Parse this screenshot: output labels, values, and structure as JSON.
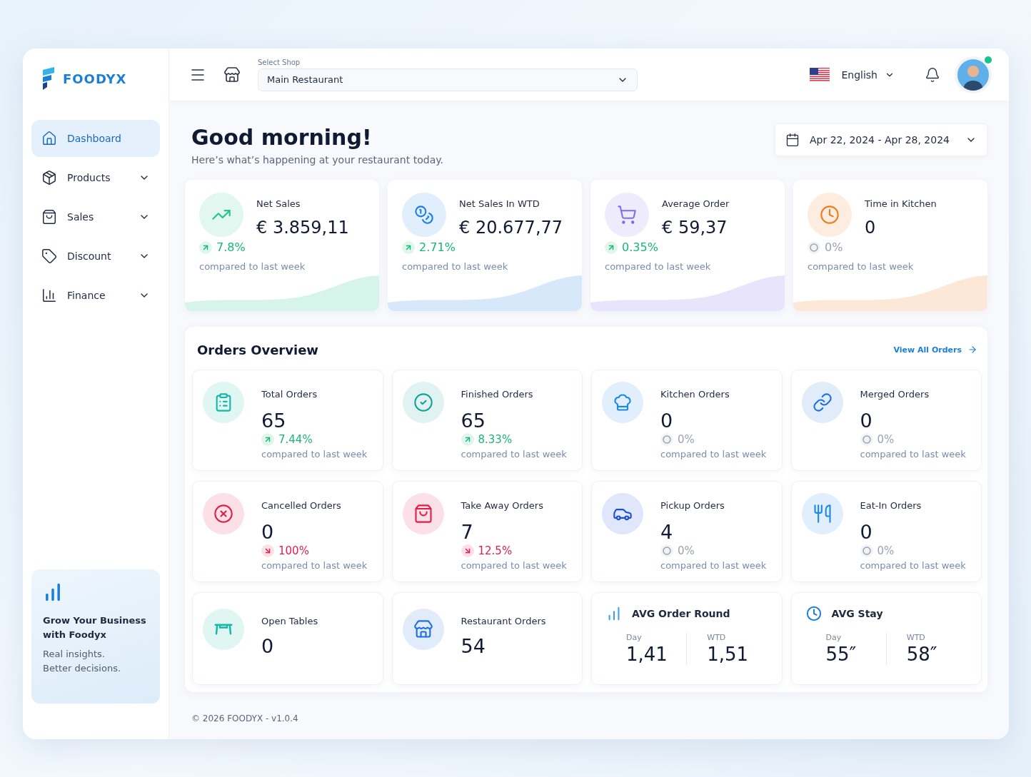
{
  "brand": {
    "name": "FOODYX"
  },
  "sidebar": {
    "items": [
      {
        "label": "Dashboard",
        "selected": true,
        "expandable": false
      },
      {
        "label": "Products",
        "selected": false,
        "expandable": true
      },
      {
        "label": "Sales",
        "selected": false,
        "expandable": true
      },
      {
        "label": "Discount",
        "selected": false,
        "expandable": true
      },
      {
        "label": "Finance",
        "selected": false,
        "expandable": true
      }
    ],
    "promo": {
      "title": "Grow Your Business with Foodyx",
      "text": "Real insights.\nBetter decisions."
    }
  },
  "header": {
    "shop_label": "Select Shop",
    "shop_value": "Main Restaurant",
    "language": "English",
    "avatar_online": true
  },
  "greeting": {
    "title": "Good morning!",
    "subtitle": "Here’s what’s happening at your restaurant today.",
    "date_range": "Apr 22, 2024 - Apr 28, 2024"
  },
  "kpis": [
    {
      "title": "Net Sales",
      "value": "€ 3.859,11",
      "change": {
        "kind": "up",
        "text": "7.8%"
      },
      "note": "compared to last week",
      "color": "#22c38e"
    },
    {
      "title": "Net Sales In WTD",
      "value": "€ 20.677,77",
      "change": {
        "kind": "up",
        "text": "2.71%"
      },
      "note": "compared to last week",
      "color": "#1e7ee6"
    },
    {
      "title": "Average Order",
      "value": "€ 59,37",
      "change": {
        "kind": "up",
        "text": "0.35%"
      },
      "note": "compared to last week",
      "color": "#7c6cf0"
    },
    {
      "title": "Time in Kitchen",
      "value": "0",
      "change": {
        "kind": "flat",
        "text": "0%"
      },
      "note": "compared to last week",
      "color": "#f27a1a"
    }
  ],
  "orders": {
    "title": "Orders Overview",
    "view_all": "View All Orders",
    "cards": [
      {
        "kind": "trend",
        "title": "Total Orders",
        "value": "65",
        "change": {
          "kind": "up",
          "text": "7.44%"
        },
        "note": "compared to last week",
        "color": "#14b8a6"
      },
      {
        "kind": "trend",
        "title": "Finished Orders",
        "value": "65",
        "change": {
          "kind": "up",
          "text": "8.33%"
        },
        "note": "compared to last week",
        "color": "#14a39a"
      },
      {
        "kind": "trend",
        "title": "Kitchen Orders",
        "value": "0",
        "change": {
          "kind": "flat",
          "text": "0%"
        },
        "note": "compared to last week",
        "color": "#1e88e5"
      },
      {
        "kind": "trend",
        "title": "Merged Orders",
        "value": "0",
        "change": {
          "kind": "flat",
          "text": "0%"
        },
        "note": "compared to last week",
        "color": "#1e6fe0"
      },
      {
        "kind": "trend",
        "title": "Cancelled Orders",
        "value": "0",
        "change": {
          "kind": "down",
          "text": "100%"
        },
        "note": "compared to last week",
        "color": "#e11d48"
      },
      {
        "kind": "trend",
        "title": "Take Away Orders",
        "value": "7",
        "change": {
          "kind": "down",
          "text": "12.5%"
        },
        "note": "compared to last week",
        "color": "#e11d48"
      },
      {
        "kind": "trend",
        "title": "Pickup Orders",
        "value": "4",
        "change": {
          "kind": "flat",
          "text": "0%"
        },
        "note": "compared to last week",
        "color": "#1d4ed8"
      },
      {
        "kind": "trend",
        "title": "Eat-In Orders",
        "value": "0",
        "change": {
          "kind": "flat",
          "text": "0%"
        },
        "note": "compared to last week",
        "color": "#1e88e5"
      },
      {
        "kind": "simple",
        "title": "Open Tables",
        "value": "0",
        "color": "#14b8a6"
      },
      {
        "kind": "simple",
        "title": "Restaurant Orders",
        "value": "54",
        "color": "#1e6fe0"
      },
      {
        "kind": "split",
        "title": "AVG Order Round",
        "parts": [
          {
            "label": "Day",
            "value": "1,41"
          },
          {
            "label": "WTD",
            "value": "1,51"
          }
        ],
        "color": "#3b9cf0"
      },
      {
        "kind": "split",
        "title": "AVG Stay",
        "parts": [
          {
            "label": "Day",
            "value": "55″"
          },
          {
            "label": "WTD",
            "value": "58″"
          }
        ],
        "color": "#1e7ee6"
      }
    ]
  },
  "footer": "© 2026 FOODYX - v1.0.4"
}
